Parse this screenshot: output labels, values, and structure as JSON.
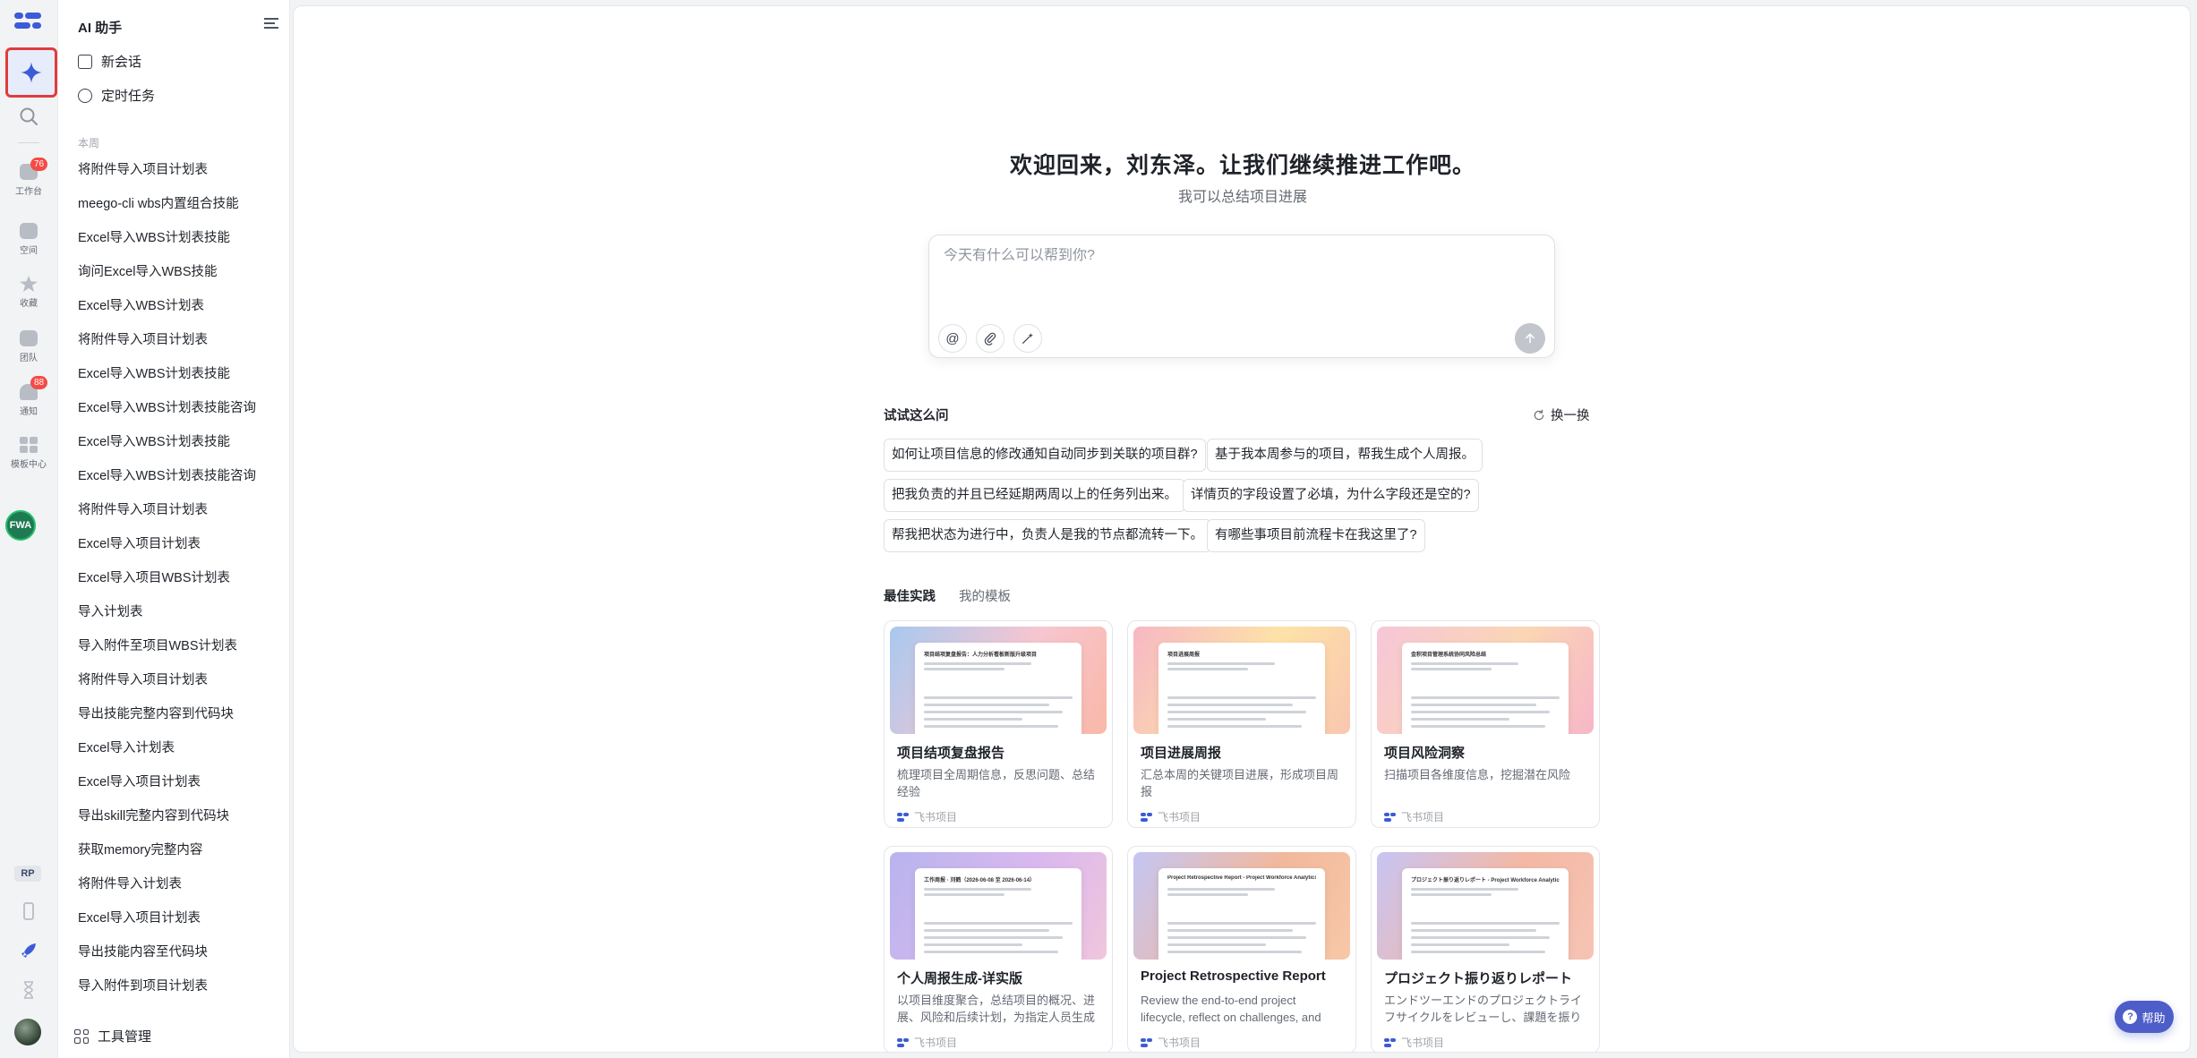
{
  "rail": {
    "items": [
      {
        "label": "工作台",
        "badge": "76"
      },
      {
        "label": "空间",
        "badge": ""
      },
      {
        "label": "收藏",
        "badge": ""
      },
      {
        "label": "团队",
        "badge": ""
      },
      {
        "label": "通知",
        "badge": "88"
      },
      {
        "label": "模板中心",
        "badge": ""
      }
    ],
    "avatar_text": "FWA",
    "rp_label": "RP",
    "accent": "#3c5bd6"
  },
  "sidebar": {
    "title": "AI 助手",
    "new_chat": "新会话",
    "scheduled": "定时任务",
    "section": "本周",
    "history": [
      "将附件导入项目计划表",
      "meego-cli wbs内置组合技能",
      "Excel导入WBS计划表技能",
      "询问Excel导入WBS技能",
      "Excel导入WBS计划表",
      "将附件导入项目计划表",
      "Excel导入WBS计划表技能",
      "Excel导入WBS计划表技能咨询",
      "Excel导入WBS计划表技能",
      "Excel导入WBS计划表技能咨询",
      "将附件导入项目计划表",
      "Excel导入项目计划表",
      "Excel导入项目WBS计划表",
      "导入计划表",
      "导入附件至项目WBS计划表",
      "将附件导入项目计划表",
      "导出技能完整内容到代码块",
      "Excel导入计划表",
      "Excel导入项目计划表",
      "导出skill完整内容到代码块",
      "获取memory完整内容",
      "将附件导入计划表",
      "Excel导入项目计划表",
      "导出技能内容至代码块",
      "导入附件到项目计划表"
    ],
    "tools": "工具管理"
  },
  "main": {
    "welcome": "欢迎回来，刘东泽。让我们继续推进工作吧。",
    "subtitle": "我可以总结项目进展",
    "composer_placeholder": "今天有什么可以帮到你?",
    "at_icon": "@",
    "try_title": "试试这么问",
    "refresh": "换一换",
    "suggestions": [
      "如何让项目信息的修改通知自动同步到关联的项目群?",
      "基于我本周参与的项目，帮我生成个人周报。",
      "把我负责的并且已经延期两周以上的任务列出来。",
      "详情页的字段设置了必填，为什么字段还是空的?",
      "帮我把状态为进行中，负责人是我的节点都流转一下。",
      "有哪些事项目前流程卡在我这里了?"
    ],
    "tab_best": "最佳实践",
    "tab_mine": "我的模板",
    "cards": [
      {
        "title": "项目结项复盘报告",
        "desc": "梳理项目全周期信息，反思问题、总结经验",
        "source": "飞书项目",
        "thumb_title": "项目结项复盘报告：人力分析看板新版升级项目",
        "colors": [
          "#a8c8f0",
          "#f7c6d0",
          "#f9b8a8"
        ]
      },
      {
        "title": "项目进展周报",
        "desc": "汇总本周的关键项目进展，形成项目周报",
        "source": "飞书项目",
        "thumb_title": "项目进展周报",
        "colors": [
          "#f7b7c4",
          "#fde3a7",
          "#f9c6b0"
        ]
      },
      {
        "title": "项目风险洞察",
        "desc": "扫描项目各维度信息，挖掘潜在风险",
        "source": "飞书项目",
        "thumb_title": "金积项目管理系统协同风险总结",
        "colors": [
          "#f6c6d8",
          "#fbd6b4",
          "#f7b6c8"
        ]
      },
      {
        "title": "个人周报生成-详实版",
        "desc": "以项目维度聚合，总结项目的概况、进展、风险和后续计划，为指定人员生成本周周报",
        "source": "飞书项目",
        "thumb_title": "工作周报 · 刘鹤（2026-06-08 至 2026-06-14）",
        "colors": [
          "#b8b4ee",
          "#d9b8ee",
          "#f0c6dc"
        ]
      },
      {
        "title": "Project Retrospective Report",
        "desc": "Review the end-to-end project lifecycle, reflect on challenges, and summarize lessons",
        "source": "飞书项目",
        "thumb_title": "Project Retrospective Report - Project Workforce Analytics New Data Acquisition API",
        "colors": [
          "#c4c6f4",
          "#f2b89c",
          "#f7c8a8"
        ]
      },
      {
        "title": "プロジェクト振り返りレポート",
        "desc": "エンドツーエンドのプロジェクトライフサイクルをレビューし、課題を振り返る",
        "source": "飞书项目",
        "thumb_title": "プロジェクト振り返りレポート - Project Workforce Analytics New Data Acquisition API",
        "colors": [
          "#c8c4f4",
          "#f4b8a4",
          "#f6c4b4"
        ]
      }
    ],
    "help": "帮助"
  }
}
